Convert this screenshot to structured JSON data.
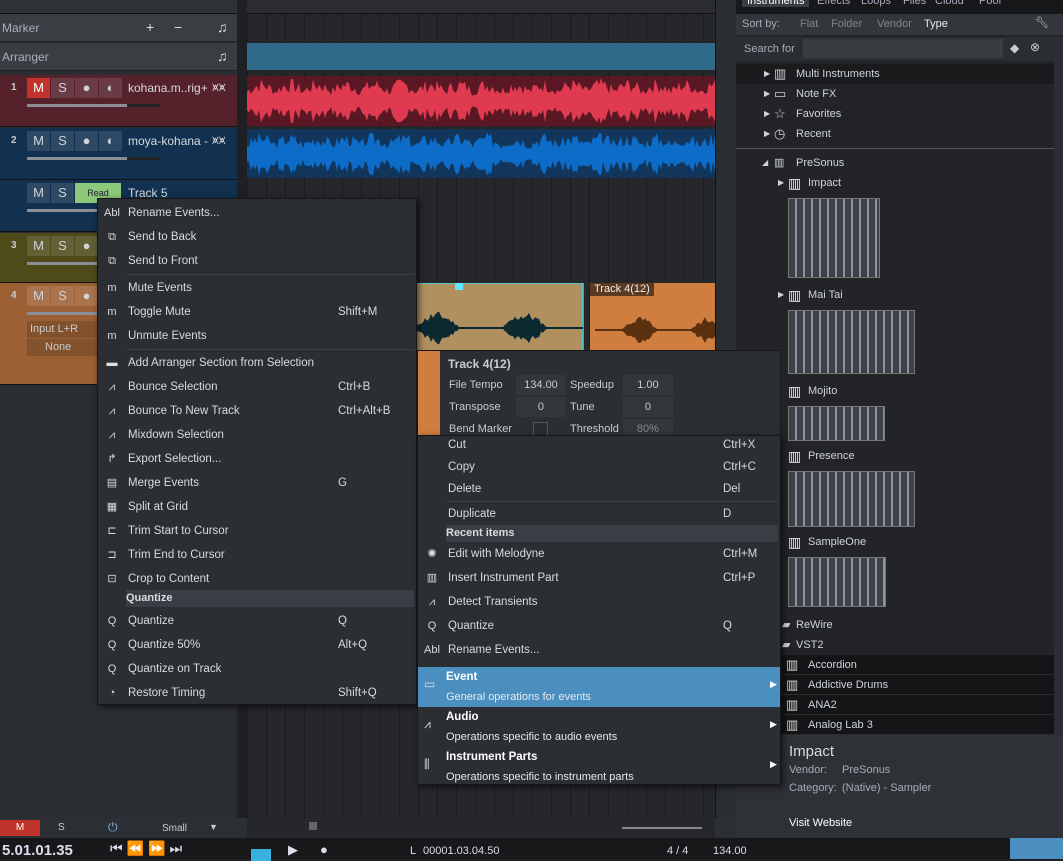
{
  "tracks_panel": {
    "marker": "Marker",
    "arranger": "Arranger",
    "tracks": [
      {
        "num": "1",
        "name": "kohana.m..rig+",
        "color": "#55222c",
        "m": "M",
        "s": "S"
      },
      {
        "num": "2",
        "name": "moya-kohana -",
        "color": "#12304f",
        "m": "M",
        "s": "S"
      },
      {
        "num": "",
        "name": "Track 5",
        "color": "#12304f",
        "m": "M",
        "s": "S",
        "auto": "Read"
      },
      {
        "num": "3",
        "name": "",
        "color": "#4f4a1a",
        "m": "M",
        "s": "S"
      },
      {
        "num": "4",
        "name": "",
        "color": "#9c6035",
        "m": "M",
        "s": "S",
        "input": "Input L+R",
        "output": "None"
      }
    ]
  },
  "event_label": "Track 4(12)",
  "info": {
    "title": "Track 4(12)",
    "file_tempo_label": "File Tempo",
    "file_tempo": "134.00",
    "speedup_label": "Speedup",
    "speedup": "1.00",
    "transpose_label": "Transpose",
    "transpose": "0",
    "tune_label": "Tune",
    "tune": "0",
    "bend_label": "Bend Marker",
    "threshold_label": "Threshold",
    "threshold": "80%"
  },
  "menu1": [
    {
      "icon": "rename-icon",
      "g": "Abl",
      "label": "Rename Events...",
      "sc": ""
    },
    {
      "icon": "send-back-icon",
      "g": "⧉",
      "label": "Send to Back",
      "sc": ""
    },
    {
      "icon": "send-front-icon",
      "g": "⧉",
      "label": "Send to Front",
      "sc": "",
      "sep": true
    },
    {
      "icon": "mute-icon",
      "g": "m",
      "label": "Mute Events",
      "sc": ""
    },
    {
      "icon": "mute-icon",
      "g": "m",
      "label": "Toggle Mute",
      "sc": "Shift+M"
    },
    {
      "icon": "mute-icon",
      "g": "m",
      "label": "Unmute Events",
      "sc": "",
      "sep": true
    },
    {
      "icon": "arranger-icon",
      "g": "▬",
      "label": "Add Arranger Section from Selection",
      "sc": ""
    },
    {
      "icon": "bounce-icon",
      "g": "⩘",
      "label": "Bounce Selection",
      "sc": "Ctrl+B"
    },
    {
      "icon": "bounce-icon",
      "g": "⩘",
      "label": "Bounce To New Track",
      "sc": "Ctrl+Alt+B"
    },
    {
      "icon": "mixdown-icon",
      "g": "⩘",
      "label": "Mixdown Selection",
      "sc": ""
    },
    {
      "icon": "export-icon",
      "g": "↱",
      "label": "Export Selection...",
      "sc": ""
    },
    {
      "icon": "merge-icon",
      "g": "▤",
      "label": "Merge Events",
      "sc": "G"
    },
    {
      "icon": "split-icon",
      "g": "▦",
      "label": "Split at Grid",
      "sc": ""
    },
    {
      "icon": "trim-start-icon",
      "g": "⊏",
      "label": "Trim Start to Cursor",
      "sc": ""
    },
    {
      "icon": "trim-end-icon",
      "g": "⊐",
      "label": "Trim End to Cursor",
      "sc": ""
    },
    {
      "icon": "crop-icon",
      "g": "⊡",
      "label": "Crop to Content",
      "sc": "",
      "head": "Quantize"
    },
    {
      "icon": "quantize-icon",
      "g": "Q",
      "label": "Quantize",
      "sc": "Q"
    },
    {
      "icon": "quantize-50-icon",
      "g": "Q",
      "label": "Quantize 50%",
      "sc": "Alt+Q"
    },
    {
      "icon": "quantize-icon",
      "g": "Q",
      "label": "Quantize on Track",
      "sc": ""
    },
    {
      "icon": "restore-timing-icon",
      "g": "◔",
      "label": "Restore Timing",
      "sc": "Shift+Q"
    }
  ],
  "menu2": {
    "items": [
      {
        "icon": "",
        "g": "",
        "label": "Cut",
        "sc": "Ctrl+X"
      },
      {
        "icon": "",
        "g": "",
        "label": "Copy",
        "sc": "Ctrl+C"
      },
      {
        "icon": "",
        "g": "",
        "label": "Delete",
        "sc": "Del",
        "sep": true
      },
      {
        "icon": "",
        "g": "",
        "label": "Duplicate",
        "sc": "D",
        "head": "Recent items"
      },
      {
        "icon": "melodyne-icon",
        "g": "✺",
        "label": "Edit with Melodyne",
        "sc": "Ctrl+M"
      },
      {
        "icon": "instrument-part-icon",
        "g": "▥",
        "label": "Insert Instrument Part",
        "sc": "Ctrl+P"
      },
      {
        "icon": "transients-icon",
        "g": "⩘",
        "label": "Detect Transients",
        "sc": ""
      },
      {
        "icon": "quantize-icon",
        "g": "Q",
        "label": "Quantize",
        "sc": "Q"
      },
      {
        "icon": "rename-icon",
        "g": "Abl",
        "label": "Rename Events...",
        "sc": ""
      }
    ],
    "subs": [
      {
        "icon": "event-icon",
        "g": "▭",
        "label": "Event",
        "desc": "General operations for events",
        "active": true
      },
      {
        "icon": "audio-icon",
        "g": "⩘",
        "label": "Audio",
        "desc": "Operations specific to audio events"
      },
      {
        "icon": "instrument-parts-icon",
        "g": "⫼",
        "label": "Instrument Parts",
        "desc": "Operations specific to instrument parts"
      }
    ]
  },
  "browser": {
    "tabs": [
      "Instruments",
      "Effects",
      "Loops",
      "Files",
      "Cloud",
      "Pool"
    ],
    "sort_label": "Sort by:",
    "sort": [
      "Flat",
      "Folder",
      "Vendor",
      "Type"
    ],
    "sort_active": "Type",
    "search_label": "Search for",
    "search_value": "",
    "folders": [
      "Multi Instruments",
      "Note FX",
      "Favorites",
      "Recent"
    ],
    "vendor": "PreSonus",
    "presonus": [
      "Impact",
      "Mai Tai",
      "Mojito",
      "Presence",
      "SampleOne"
    ],
    "other": [
      "ReWire",
      "VST2"
    ],
    "vst": [
      "Accordion",
      "Addictive Drums",
      "ANA2",
      "Analog Lab 3"
    ],
    "detail": {
      "name": "Impact",
      "vendor_label": "Vendor:",
      "vendor": "PreSonus",
      "category_label": "Category:",
      "category": "(Native) - Sampler",
      "website": "Visit Website"
    }
  },
  "bottom": {
    "m": "M",
    "s": "S",
    "size": "Small"
  },
  "transport": {
    "time": "5.01.01.35",
    "loop_l": "00001.03.04.50",
    "signature": "4 / 4",
    "tempo": "134.00"
  },
  "colors": {
    "track1_wave": "#e03a50",
    "track2_wave": "#0c6cc8",
    "arranger": "#306a8a",
    "highlight": "#4a8fbf",
    "read": "#8cc97a"
  }
}
